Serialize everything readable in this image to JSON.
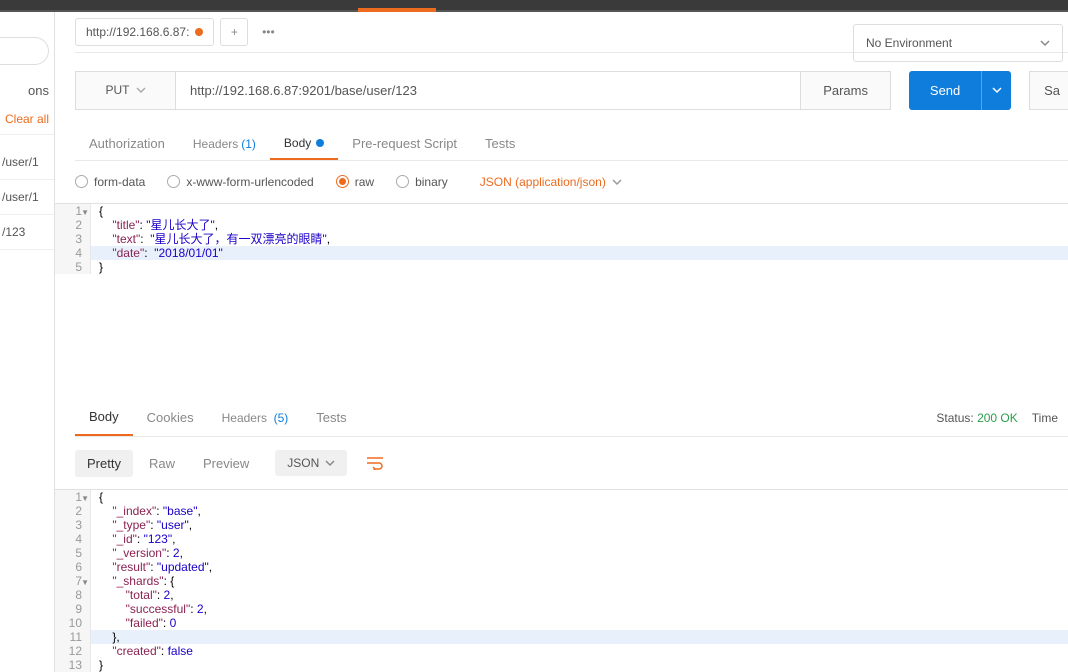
{
  "sidebar": {
    "search_placeholder": "",
    "ons_label": "ons",
    "clear_all": "Clear all",
    "history": [
      "/user/1",
      "/user/1",
      "/123"
    ]
  },
  "tabs": {
    "current": "http://192.168.6.87:"
  },
  "environment": {
    "selected": "No Environment"
  },
  "request": {
    "method": "PUT",
    "url": "http://192.168.6.87:9201/base/user/123",
    "params_btn": "Params",
    "send_btn": "Send",
    "save_btn": "Sa"
  },
  "req_tabs": {
    "authorization": "Authorization",
    "headers": "Headers",
    "headers_count": "(1)",
    "body": "Body",
    "pre_request": "Pre-request Script",
    "tests": "Tests"
  },
  "body_opts": {
    "form_data": "form-data",
    "urlencoded": "x-www-form-urlencoded",
    "raw": "raw",
    "binary": "binary",
    "content_type": "JSON (application/json)"
  },
  "request_body": {
    "l1": "{",
    "l2k": "\"title\"",
    "l2v": "\"星儿长大了\"",
    "l3k": "\"text\"",
    "l3v": "\"星儿长大了，有一双漂亮的眼睛\"",
    "l4k": "\"date\"",
    "l4v": "\"2018/01/01\"",
    "l5": "}"
  },
  "resp_tabs": {
    "body": "Body",
    "cookies": "Cookies",
    "headers": "Headers",
    "headers_count": "(5)",
    "tests": "Tests"
  },
  "status": {
    "status_label": "Status:",
    "status_value": "200 OK",
    "time_label": "Time"
  },
  "view_modes": {
    "pretty": "Pretty",
    "raw": "Raw",
    "preview": "Preview",
    "json": "JSON"
  },
  "response_body": {
    "l1": "{",
    "l2k": "\"_index\"",
    "l2v": "\"base\"",
    "l3k": "\"_type\"",
    "l3v": "\"user\"",
    "l4k": "\"_id\"",
    "l4v": "\"123\"",
    "l5k": "\"_version\"",
    "l5v": "2",
    "l6k": "\"result\"",
    "l6v": "\"updated\"",
    "l7k": "\"_shards\"",
    "l7v": "{",
    "l8k": "\"total\"",
    "l8v": "2",
    "l9k": "\"successful\"",
    "l9v": "2",
    "l10k": "\"failed\"",
    "l10v": "0",
    "l11": "},",
    "l12k": "\"created\"",
    "l12v": "false",
    "l13": "}"
  }
}
